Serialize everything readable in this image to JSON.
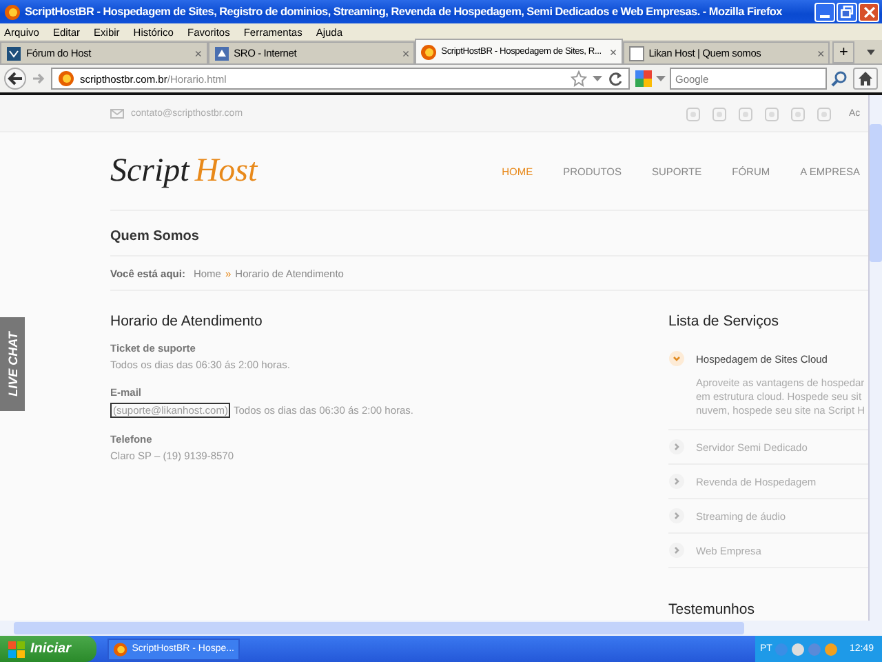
{
  "window": {
    "title": "ScriptHostBR - Hospedagem de Sites, Registro de dominios, Streaming, Revenda de Hospedagem, Semi Dedicados e Web Empresas. - Mozilla Firefox"
  },
  "menu": [
    "Arquivo",
    "Editar",
    "Exibir",
    "Histórico",
    "Favoritos",
    "Ferramentas",
    "Ajuda"
  ],
  "tabs": [
    {
      "label": "Fórum do Host",
      "selected": false,
      "close": "×"
    },
    {
      "label": "SRO - Internet",
      "selected": false,
      "close": "×"
    },
    {
      "label": "ScriptHostBR - Hospedagem de Sites, R...",
      "selected": true,
      "close": "×"
    },
    {
      "label": "Likan Host | Quem somos",
      "selected": false,
      "close": "×"
    }
  ],
  "new_tab": "+",
  "address": {
    "domain": "scripthostbr.com.br",
    "path": "/Horario.html"
  },
  "search": {
    "placeholder": "Google"
  },
  "page": {
    "top_bar": {
      "email": "contato@scripthostbr.com",
      "cut_text": "Ac"
    },
    "logo": {
      "part_1": "Script",
      "part_2": "Host"
    },
    "nav": [
      {
        "label": "HOME",
        "selected": true
      },
      {
        "label": "PRODUTOS",
        "selected": false
      },
      {
        "label": "SUPORTE",
        "selected": false
      },
      {
        "label": "FÓRUM",
        "selected": false
      },
      {
        "label": "A EMPRESA",
        "selected": false
      }
    ],
    "page_title": "Quem Somos",
    "breadcrumb": {
      "label": "Você está aqui:",
      "items": [
        "Home",
        "Horario de Atendimento"
      ],
      "separator": "»"
    },
    "live_chat": "LIVE CHAT",
    "main": {
      "heading": "Horario de Atendimento",
      "sections": [
        {
          "label": "Ticket de suporte",
          "text": "Todos os dias das 06:30 ás 2:00 horas."
        },
        {
          "label": "E-mail",
          "link": "(suporte@likanhost.com)",
          "text": "Todos os dias das 06:30 ás 2:00 horas."
        },
        {
          "label": "Telefone",
          "text": "Claro SP – (19) 9139-8570"
        }
      ]
    },
    "services": {
      "heading": "Lista de Serviços",
      "items": [
        {
          "label": "Hospedagem de Sites Cloud",
          "expanded": true,
          "description": [
            "Aproveite as vantagens de hospedar",
            "em estrutura cloud. Hospede seu sit",
            "nuvem, hospede seu site na Script H"
          ]
        },
        {
          "label": "Servidor Semi Dedicado",
          "expanded": false
        },
        {
          "label": "Revenda de Hospedagem",
          "expanded": false
        },
        {
          "label": "Streaming de áudio",
          "expanded": false
        },
        {
          "label": "Web Empresa",
          "expanded": false
        }
      ]
    },
    "testimonials": {
      "heading": "Testemunhos"
    }
  },
  "taskbar": {
    "start": "Iniciar",
    "task": "ScriptHostBR - Hospe...",
    "language": "PT",
    "clock": "12:49"
  }
}
